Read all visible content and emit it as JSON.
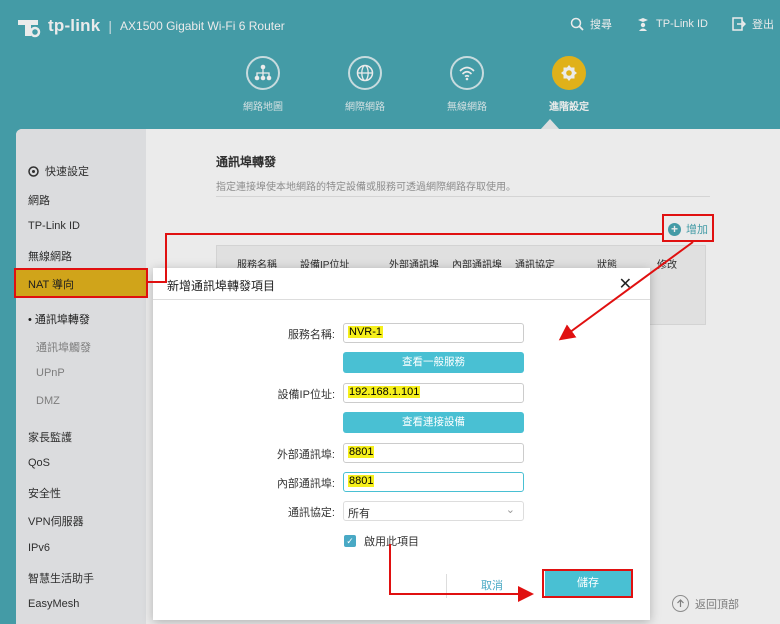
{
  "header": {
    "brand": "tp-link",
    "separator": "|",
    "model": "AX1500 Gigabit Wi-Fi 6 Router",
    "links": [
      {
        "label": "搜尋",
        "icon": "search-icon"
      },
      {
        "label": "TP-Link ID",
        "icon": "user-id-icon"
      },
      {
        "label": "登出",
        "icon": "logout-icon"
      }
    ],
    "nav": [
      {
        "label": "網路地圖",
        "icon": "network-map-icon"
      },
      {
        "label": "網際網路",
        "icon": "globe-icon"
      },
      {
        "label": "無線網路",
        "icon": "wifi-icon"
      },
      {
        "label": "進階設定",
        "icon": "gear-icon",
        "active": true
      }
    ]
  },
  "sidebar": {
    "items": [
      {
        "label": "快速設定"
      },
      {
        "label": "網路"
      },
      {
        "label": "TP-Link ID"
      },
      {
        "label": "無線網路"
      },
      {
        "label": "NAT 導向"
      }
    ],
    "subitems": [
      {
        "label": "通訊埠轉發",
        "active": true
      },
      {
        "label": "通訊埠觸發"
      },
      {
        "label": "UPnP"
      },
      {
        "label": "DMZ"
      }
    ],
    "items_after": [
      {
        "label": "家長監護"
      },
      {
        "label": "QoS"
      },
      {
        "label": "安全性"
      },
      {
        "label": "VPN伺服器"
      },
      {
        "label": "IPv6"
      },
      {
        "label": "智慧生活助手"
      },
      {
        "label": "EasyMesh"
      }
    ]
  },
  "main": {
    "title": "通訊埠轉發",
    "description": "指定連接埠使本地網路的特定設備或服務可透過網際網路存取使用。",
    "add_label": "增加",
    "table_headers": [
      "服務名稱",
      "設備IP位址",
      "外部通訊埠",
      "內部通訊埠",
      "通訊協定",
      "狀態",
      "修改"
    ],
    "back_to_top": "返回頂部"
  },
  "modal": {
    "title": "新增通訊埠轉發項目",
    "close": "✕",
    "service_name_label": "服務名稱:",
    "service_name_value": "NVR-1",
    "view_services_button": "查看一般服務",
    "device_ip_label": "設備IP位址:",
    "device_ip_value": "192.168.1.101",
    "view_devices_button": "查看連接設備",
    "external_port_label": "外部通訊埠:",
    "external_port_value": "8801",
    "internal_port_label": "內部通訊埠:",
    "internal_port_value": "8801",
    "protocol_label": "通訊協定:",
    "protocol_value": "所有",
    "enable_label": "啟用此項目",
    "cancel_label": "取消",
    "save_label": "儲存"
  },
  "colors": {
    "header_bg": "#4aa9b5",
    "accent": "#49c0d3",
    "active_nav": "#f3c11d",
    "annotation_red": "#e01010",
    "highlight_yellow": "#f6f01b"
  }
}
